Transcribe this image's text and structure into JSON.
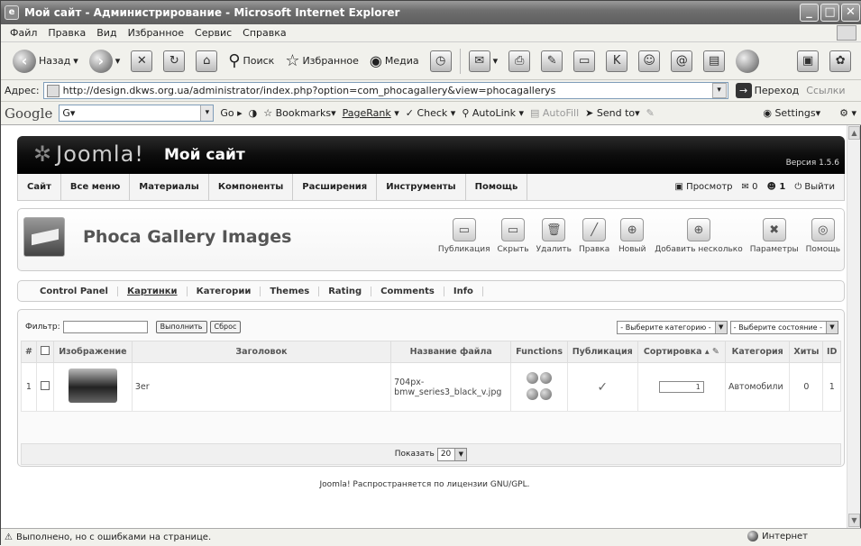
{
  "window": {
    "title": "Мой сайт - Администрирование - Microsoft Internet Explorer"
  },
  "menubar": [
    "Файл",
    "Правка",
    "Вид",
    "Избранное",
    "Сервис",
    "Справка"
  ],
  "toolbar": {
    "back": "Назад",
    "search": "Поиск",
    "favorites": "Избранное",
    "media": "Медиа"
  },
  "address": {
    "label": "Адрес:",
    "url": "http://design.dkws.org.ua/administrator/index.php?option=com_phocagallery&view=phocagallerys",
    "go": "Переход",
    "links": "Ссылки"
  },
  "googlebar": {
    "logo": "Google",
    "search_value": "G▾",
    "go": "Go",
    "bookmarks": "Bookmarks",
    "pagerank": "PageRank",
    "check": "Check",
    "autolink": "AutoLink",
    "autofill": "AutoFill",
    "sendto": "Send to",
    "settings": "Settings"
  },
  "joomla": {
    "logo": "Joomla!",
    "site": "Мой сайт",
    "version": "Версия 1.5.6",
    "menu": [
      "Сайт",
      "Все меню",
      "Материалы",
      "Компоненты",
      "Расширения",
      "Инструменты",
      "Помощь"
    ],
    "menu_right": {
      "preview": "Просмотр",
      "count1": "0",
      "count2": "1",
      "logout": "Выйти"
    },
    "component_title": "Phoca Gallery Images",
    "buttons": [
      "Публикация",
      "Скрыть",
      "Удалить",
      "Правка",
      "Новый",
      "Добавить несколько",
      "Параметры",
      "Помощь"
    ],
    "submenu": [
      "Control Panel",
      "Картинки",
      "Категории",
      "Themes",
      "Rating",
      "Comments",
      "Info"
    ],
    "filter_label": "Фильтр:",
    "filter_go": "Выполнить",
    "filter_reset": "Сброс",
    "cat_select": "- Выберите категорию -",
    "state_select": "- Выберите состояние -",
    "columns": [
      "#",
      "",
      "Изображение",
      "Заголовок",
      "Название файла",
      "Functions",
      "Публикация",
      "Сортировка",
      "Категория",
      "Хиты",
      "ID"
    ],
    "rows": [
      {
        "num": "1",
        "title": "3er",
        "filename": "704px-bmw_series3_black_v.jpg",
        "order": "1",
        "category": "Автомобили",
        "hits": "0",
        "id": "1"
      }
    ],
    "show_label": "Показать",
    "show_value": "20",
    "footer": "Joomla! Распространяется по лицензии GNU/GPL."
  },
  "status": {
    "left": "Выполнено, но с ошибками на странице.",
    "zone": "Интернет"
  }
}
